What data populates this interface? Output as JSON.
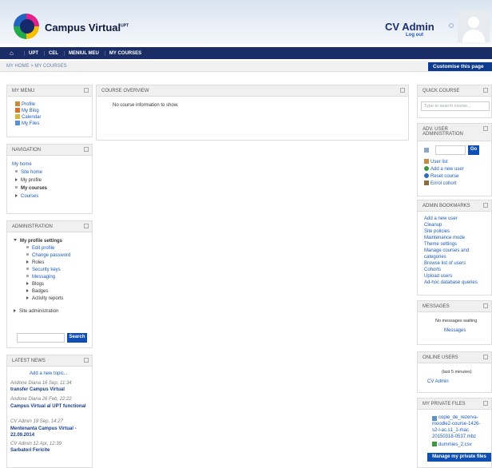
{
  "header": {
    "brand": "Campus Virtual",
    "brand_sup": "UPT",
    "user_name": "CV Admin",
    "logout": "Log out"
  },
  "navbar": {
    "items": [
      "UPT",
      "CEL",
      "MENIUL MEU",
      "MY COURSES"
    ]
  },
  "breadcrumb": "MY HOME  >  MY COURSES",
  "customise_label": "Customise this page",
  "my_menu": {
    "title": "MY MENU",
    "items": [
      "Profile",
      "My Blog",
      "Calendar",
      "My Files"
    ]
  },
  "navigation": {
    "title": "NAVIGATION",
    "my_home": "My home",
    "site_home": "Site home",
    "my_profile": "My profile",
    "my_courses": "My courses",
    "courses": "Courses"
  },
  "administration": {
    "title": "ADMINISTRATION",
    "profile_settings": "My profile settings",
    "items": [
      "Edit profile",
      "Change password",
      "Roles",
      "Security keys",
      "Messaging",
      "Blogs",
      "Badges",
      "Activity reports"
    ],
    "site_admin": "Site administration",
    "search_button": "Search"
  },
  "latest_news": {
    "title": "LATEST NEWS",
    "add_topic": "Add a new topic...",
    "items": [
      {
        "meta": "Andone Diana   16 Sep, 11:34",
        "title": "transfer Campus Virtual"
      },
      {
        "meta": "Andone Diana   26 Feb, 22:22",
        "title": "Campus Virtual al UPT functional"
      },
      {
        "meta": "CV Admin        19 Sep, 14:27",
        "title": "Mentenanta Campus Virtual - 22.09.2014"
      },
      {
        "meta": "CV Admin        12 Apr, 12:39",
        "title": "Sarbatori Fericite"
      }
    ]
  },
  "course_overview": {
    "title": "COURSE OVERVIEW",
    "empty": "No course information to show."
  },
  "quick_course": {
    "title": "QUICK COURSE",
    "placeholder": "Type to search course..."
  },
  "adv_user_admin": {
    "title_line1": "ADV. USER",
    "title_line2": "ADMINISTRATION",
    "go": "Go",
    "items": [
      "User list",
      "Add a new user",
      "Reset course",
      "Enrol cohort"
    ]
  },
  "admin_bookmarks": {
    "title": "ADMIN BOOKMARKS",
    "items": [
      "Add a new user",
      "Cleanup",
      "Site policies",
      "Maintenance mode",
      "Theme settings",
      "Manage courses and",
      "categories",
      "Browse list of users",
      "Cohorts",
      "Upload users",
      "Ad-hoc database queries"
    ]
  },
  "messages": {
    "title": "MESSAGES",
    "waiting": "No messages waiting",
    "link": "Messages"
  },
  "online_users": {
    "title": "ONLINE USERS",
    "note": "(last 5 minutes)",
    "user": "CV Admin"
  },
  "private_files": {
    "title": "MY PRIVATE FILES",
    "file1_lines": [
      "copie_de_rezerva-",
      "moodle2-course-1426-",
      "s2-l-ac.s1_1-mac",
      "20150318-0537.mbz"
    ],
    "file2": "dummies_2.csv",
    "manage": "Manage my private files"
  },
  "colors": {
    "nav_bg": "#1b2d66",
    "accent_button": "#0f4fb3",
    "link": "#1a5ab8"
  }
}
